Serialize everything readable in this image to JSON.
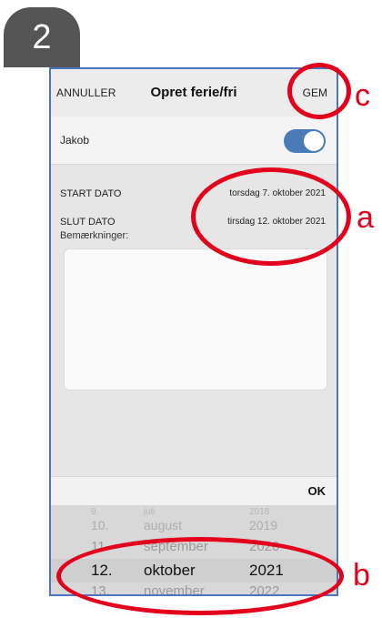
{
  "step_badge": "2",
  "nav": {
    "cancel": "ANNULLER",
    "title": "Opret ferie/fri",
    "save": "GEM"
  },
  "person": {
    "name": "Jakob",
    "toggle_on": true
  },
  "dates": {
    "start_label": "START DATO",
    "start_value": "torsdag 7. oktober 2021",
    "end_label": "SLUT DATO",
    "end_value": "tirsdag 12. oktober 2021"
  },
  "remarks": {
    "label": "Bemærkninger:",
    "value": ""
  },
  "ok_label": "OK",
  "picker": {
    "rows": [
      {
        "day": "9.",
        "month": "juli",
        "year": "2018"
      },
      {
        "day": "10.",
        "month": "august",
        "year": "2019"
      },
      {
        "day": "11.",
        "month": "september",
        "year": "2020"
      },
      {
        "day": "12.",
        "month": "oktober",
        "year": "2021"
      },
      {
        "day": "13.",
        "month": "november",
        "year": "2022"
      }
    ]
  },
  "annotations": {
    "a": "a",
    "b": "b",
    "c": "c"
  },
  "colors": {
    "annotation": "#e3001b",
    "toggle": "#4a7bb8",
    "frame": "#4a78c0"
  }
}
